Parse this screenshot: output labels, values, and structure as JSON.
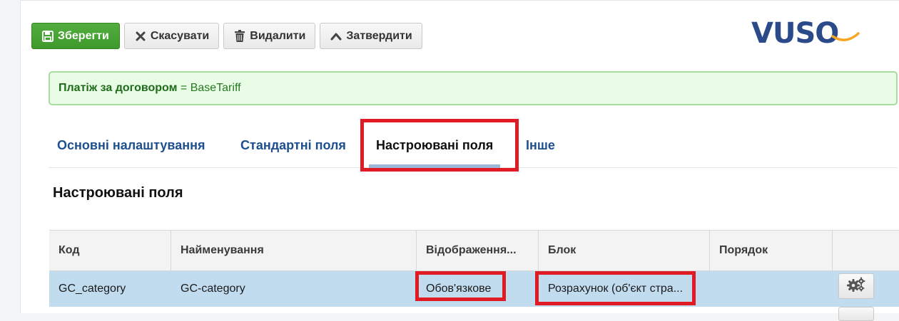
{
  "toolbar": {
    "save_label": "Зберегти",
    "cancel_label": "Скасувати",
    "delete_label": "Видалити",
    "approve_label": "Затвердити"
  },
  "logo": {
    "text": "VUSO",
    "color": "#2a4a8a",
    "accent": "#f5a623"
  },
  "info": {
    "label": "Платіж за договором",
    "operator": " = ",
    "value": "BaseTariff"
  },
  "tabs": [
    {
      "label": "Основні налаштування"
    },
    {
      "label": "Стандартні поля"
    },
    {
      "label": "Настроювані поля",
      "active": true
    },
    {
      "label": "Інше"
    }
  ],
  "section_title": "Настроювані поля",
  "table": {
    "columns": [
      "Код",
      "Найменування",
      "Відображення...",
      "Блок",
      "Порядок",
      ""
    ],
    "rows": [
      {
        "code": "GC_category",
        "name": "GC-category",
        "display": "Обов'язкове",
        "block": "Розрахунок (об'єкт стра...",
        "order": ""
      }
    ]
  },
  "colors": {
    "highlight": "#e01b24",
    "save_green": "#46a332",
    "tab_blue": "#1e4f8f",
    "row_selected": "#c1dcef"
  }
}
